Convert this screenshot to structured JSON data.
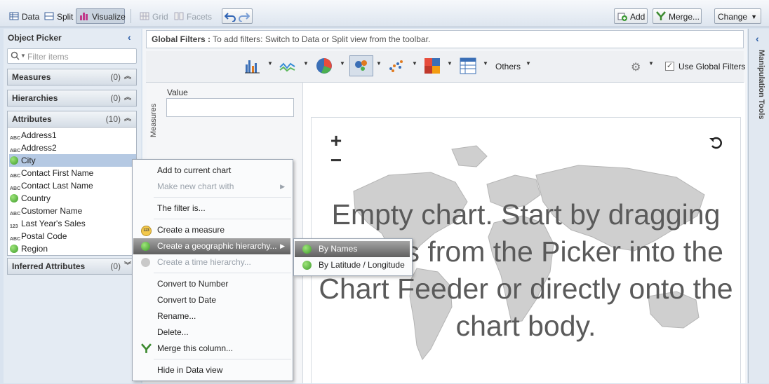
{
  "toolbar": {
    "data_label": "Data",
    "split_label": "Split",
    "visualize_label": "Visualize",
    "grid_label": "Grid",
    "facets_label": "Facets",
    "add_label": "Add",
    "merge_label": "Merge...",
    "change_label": "Change"
  },
  "object_picker": {
    "title": "Object Picker",
    "filter_placeholder": "Filter items",
    "sections": {
      "measures": {
        "label": "Measures",
        "count": "(0)"
      },
      "hierarchies": {
        "label": "Hierarchies",
        "count": "(0)"
      },
      "attributes": {
        "label": "Attributes",
        "count": "(10)"
      },
      "inferred": {
        "label": "Inferred Attributes",
        "count": "(0)"
      }
    },
    "attributes": [
      {
        "label": "Address1",
        "type": "text"
      },
      {
        "label": "Address2",
        "type": "text"
      },
      {
        "label": "City",
        "type": "geo"
      },
      {
        "label": "Contact First Name",
        "type": "text"
      },
      {
        "label": "Contact Last Name",
        "type": "text"
      },
      {
        "label": "Country",
        "type": "geo"
      },
      {
        "label": "Customer Name",
        "type": "text"
      },
      {
        "label": "Last Year's Sales",
        "type": "number"
      },
      {
        "label": "Postal Code",
        "type": "text"
      },
      {
        "label": "Region",
        "type": "geo"
      }
    ],
    "type_badges": {
      "text": "ABC",
      "number": "123"
    }
  },
  "global_filters": {
    "label": "Global Filters :",
    "hint": "To add filters: Switch to Data or Split view from the toolbar."
  },
  "chart_toolbar": {
    "others_label": "Others",
    "use_global_filters_label": "Use Global Filters",
    "use_global_filters_checked": true
  },
  "feeder": {
    "measures_label": "Measures",
    "value_label": "Value"
  },
  "chart": {
    "empty_message": "Empty chart. Start by dragging objects from the Picker into the Chart Feeder or directly onto the chart body.",
    "zoom_in": "+",
    "zoom_out": "−"
  },
  "side_tab": {
    "label": "Manipulation Tools"
  },
  "context_menu": {
    "items": [
      {
        "label": "Add to current chart",
        "disabled": false
      },
      {
        "label": "Make new chart with",
        "disabled": true
      },
      {
        "label": "The filter is...",
        "disabled": false
      },
      {
        "label": "Create a measure",
        "disabled": false
      },
      {
        "label": "Create a geographic hierarchy...",
        "disabled": false
      },
      {
        "label": "Create a time hierarchy...",
        "disabled": true
      },
      {
        "label": "Convert to Number",
        "disabled": false
      },
      {
        "label": "Convert to Date",
        "disabled": false
      },
      {
        "label": "Rename...",
        "disabled": false
      },
      {
        "label": "Delete...",
        "disabled": false
      },
      {
        "label": "Merge this column...",
        "disabled": false
      },
      {
        "label": "Hide in Data view",
        "disabled": false
      }
    ],
    "measure_badge": "123"
  },
  "submenu": {
    "items": [
      {
        "label": "By Names"
      },
      {
        "label": "By Latitude / Longitude"
      }
    ]
  },
  "colors": {
    "highlight": "#6a6a6a",
    "selection": "#b5c9e3",
    "panel": "#e4ebf3"
  }
}
